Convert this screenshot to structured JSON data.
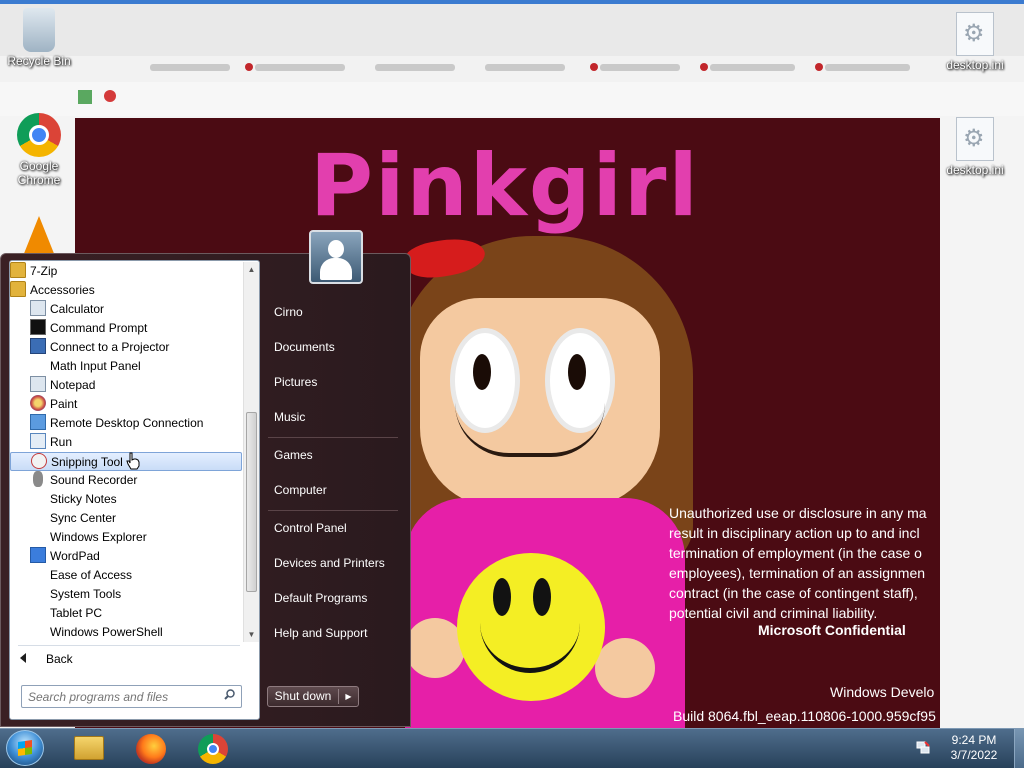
{
  "desktop_icons": {
    "recycle_bin": "Recycle Bin",
    "google_chrome": "Google Chrome",
    "desktop_ini_1": "desktop.ini",
    "desktop_ini_2": "desktop.ini"
  },
  "wallpaper": {
    "poster_title": "Pinkgirl",
    "confidential_title": "Microsoft Confidential",
    "confidential_lines": [
      "Unauthorized use or disclosure in any ma",
      "result in disciplinary action up to and incl",
      "termination of employment (in the case o",
      "employees), termination of an assignmen",
      "contract (in the case of contingent staff),",
      "potential civil and criminal liability."
    ],
    "build_line1": "Windows Develo",
    "build_line2": "Build 8064.fbl_eeap.110806-1000.959cf95"
  },
  "start_menu": {
    "programs": [
      {
        "label": "7-Zip",
        "icon": "folder-icon"
      },
      {
        "label": "Accessories",
        "icon": "folder-icon"
      },
      {
        "label": "Calculator",
        "icon": "calculator-icon"
      },
      {
        "label": "Command Prompt",
        "icon": "command-prompt-icon"
      },
      {
        "label": "Connect to a Projector",
        "icon": "projector-icon"
      },
      {
        "label": "Math Input Panel",
        "icon": "math-input-icon"
      },
      {
        "label": "Notepad",
        "icon": "notepad-icon"
      },
      {
        "label": "Paint",
        "icon": "paint-icon"
      },
      {
        "label": "Remote Desktop Connection",
        "icon": "remote-desktop-icon"
      },
      {
        "label": "Run",
        "icon": "run-icon"
      },
      {
        "label": "Snipping Tool",
        "icon": "snipping-tool-icon"
      },
      {
        "label": "Sound Recorder",
        "icon": "microphone-icon"
      },
      {
        "label": "Sticky Notes",
        "icon": "sticky-notes-icon"
      },
      {
        "label": "Sync Center",
        "icon": "sync-center-icon"
      },
      {
        "label": "Windows Explorer",
        "icon": "windows-explorer-icon"
      },
      {
        "label": "WordPad",
        "icon": "wordpad-icon"
      },
      {
        "label": "Ease of Access",
        "icon": "ease-of-access-icon"
      },
      {
        "label": "System Tools",
        "icon": "system-tools-icon"
      },
      {
        "label": "Tablet PC",
        "icon": "tablet-pc-icon"
      },
      {
        "label": "Windows PowerShell",
        "icon": "powershell-icon"
      }
    ],
    "selected_program": "Snipping Tool",
    "back_label": "Back",
    "search_placeholder": "Search programs and files",
    "right_links": {
      "user": "Cirno",
      "documents": "Documents",
      "pictures": "Pictures",
      "music": "Music",
      "games": "Games",
      "computer": "Computer",
      "control_panel": "Control Panel",
      "devices_printers": "Devices and Printers",
      "default_programs": "Default Programs",
      "help_support": "Help and Support"
    },
    "shutdown_label": "Shut down"
  },
  "taskbar": {
    "time": "9:24 PM",
    "date": "3/7/2022"
  },
  "colors": {
    "poster_bg": "#4b0b13",
    "poster_title": "#e23fae",
    "taskbar": "#3a5878"
  }
}
